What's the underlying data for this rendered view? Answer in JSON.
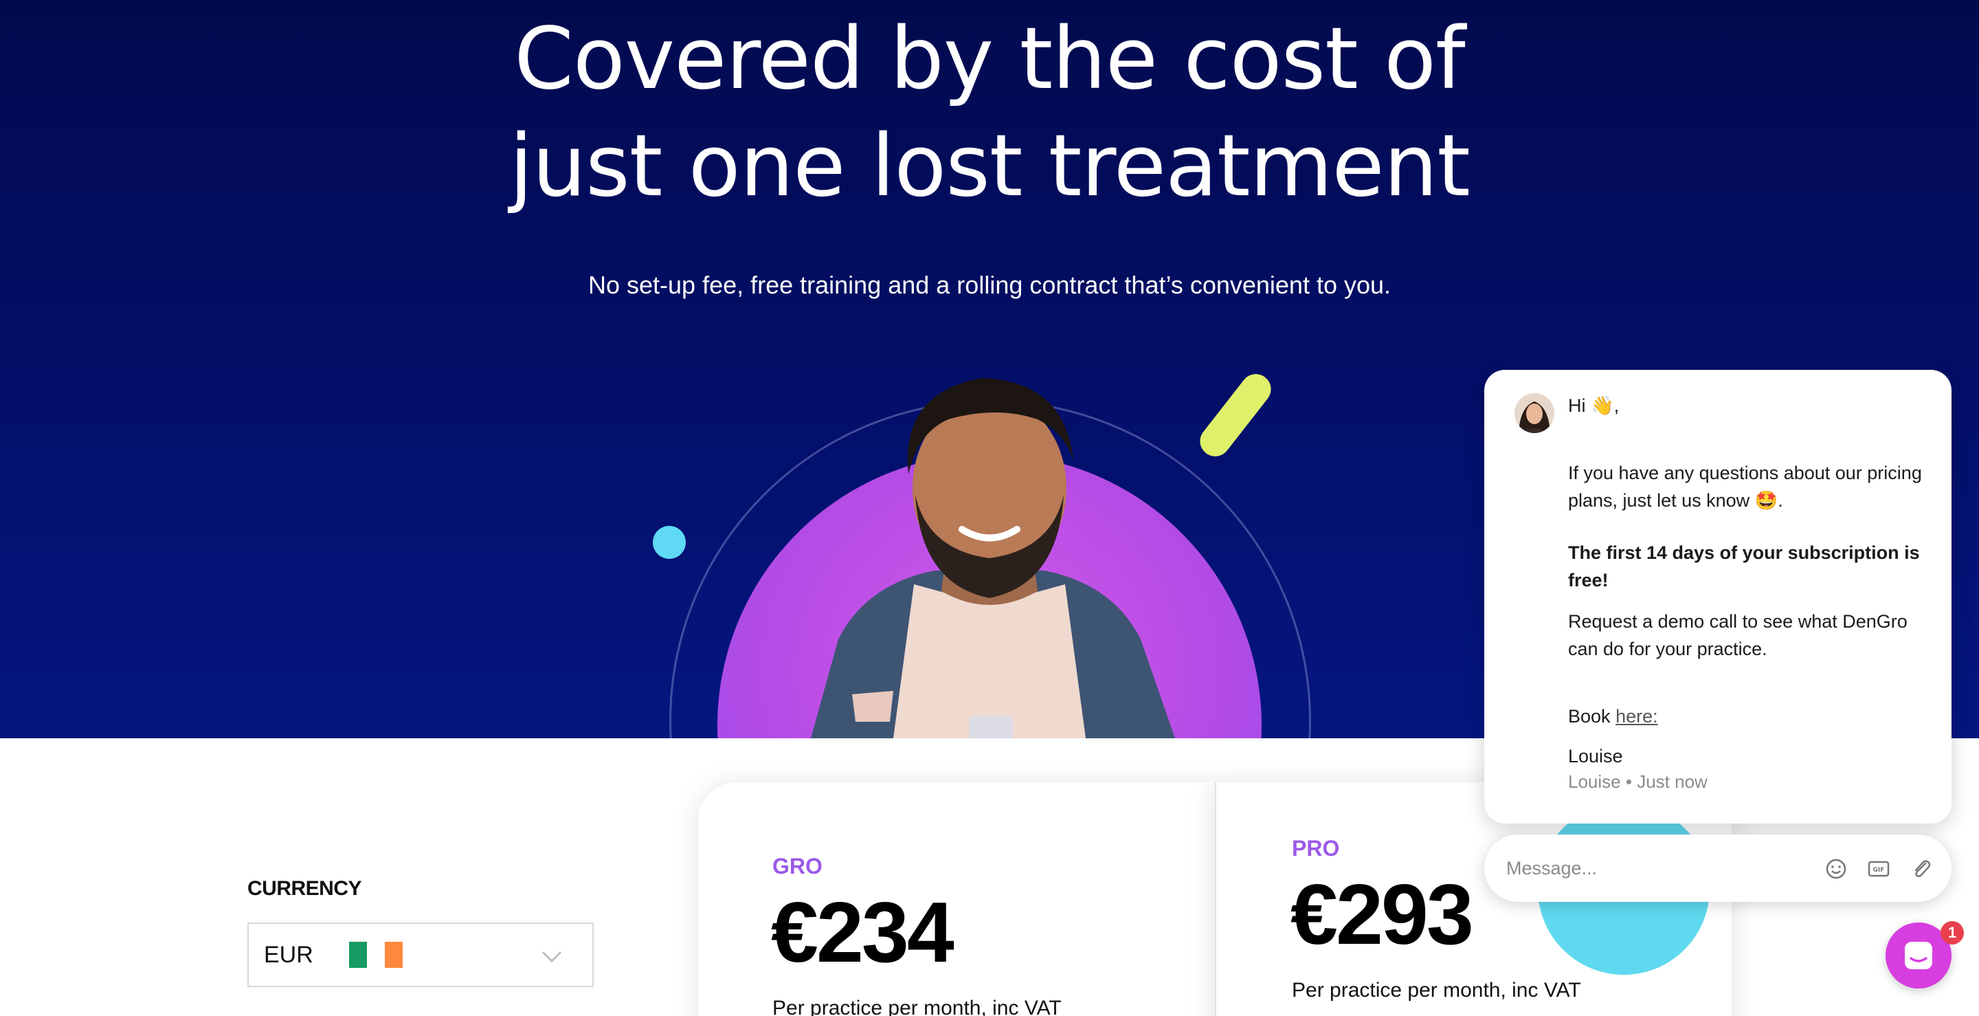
{
  "hero": {
    "title_line1": "Covered by the cost of",
    "title_line2": "just one lost treatment",
    "subtitle": "No set-up fee, free training and a rolling contract that’s convenient to you."
  },
  "currency": {
    "label": "CURRENCY",
    "selected": "EUR"
  },
  "plans": [
    {
      "name": "GRO",
      "price": "€234",
      "desc": "Per practice per month, inc VAT"
    },
    {
      "name": "PRO",
      "price": "€293",
      "desc": "Per practice per month, inc VAT"
    }
  ],
  "chat": {
    "greeting": "Hi 👋,",
    "para1": "If you have any questions about our pricing plans, just let us know 🤩.",
    "bold1": "The first 14 days of your subscription is free!",
    "para2": "Request a demo call to see what DenGro can do for your practice.",
    "book_prefix": "Book",
    "book_link": "here:",
    "signature": "Louise",
    "meta_author": "Louise",
    "meta_sep": "•",
    "meta_time": "Just now",
    "message_placeholder": "Message...",
    "unread_count": "1"
  },
  "colors": {
    "hero_bg": "#030f6a",
    "plan_accent": "#9b59e8",
    "launcher": "#d63ee0",
    "badge": "#e8404d"
  },
  "icons": {
    "emoji": "emoji-icon",
    "gif": "gif-icon",
    "attach": "paperclip-icon",
    "chevron": "chevron-down-icon",
    "chat": "chat-icon"
  }
}
